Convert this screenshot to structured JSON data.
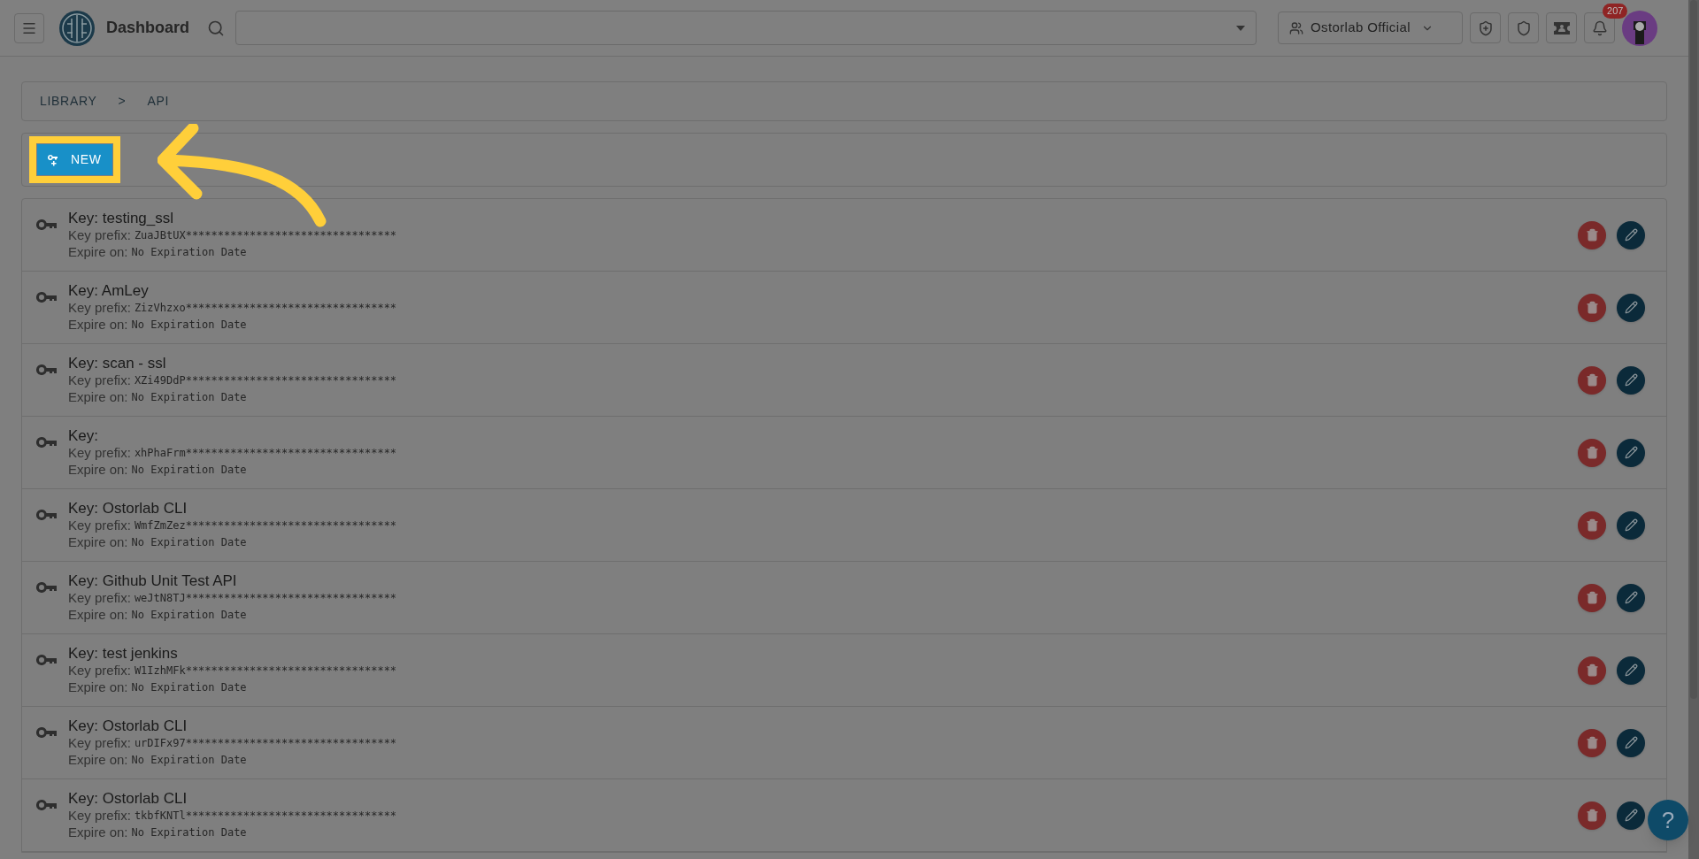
{
  "header": {
    "title": "Dashboard",
    "org_selector": "Ostorlab Official",
    "notification_count": "207"
  },
  "breadcrumb": [
    {
      "label": "LIBRARY"
    },
    {
      "label": ">"
    },
    {
      "label": "API"
    }
  ],
  "new_button": {
    "label": "NEW",
    "highlighted": true
  },
  "keys": [
    {
      "title": "Key: testing_ssl",
      "prefix_label": "Key prefix:",
      "prefix": "ZuaJBtUX*********************************",
      "expire_label": "Expire on:",
      "expire": "No Expiration Date"
    },
    {
      "title": "Key: AmLey",
      "prefix_label": "Key prefix:",
      "prefix": "ZizVhzxo*********************************",
      "expire_label": "Expire on:",
      "expire": "No Expiration Date"
    },
    {
      "title": "Key: scan - ssl",
      "prefix_label": "Key prefix:",
      "prefix": "XZi49DdP*********************************",
      "expire_label": "Expire on:",
      "expire": "No Expiration Date"
    },
    {
      "title": "Key:",
      "prefix_label": "Key prefix:",
      "prefix": "xhPhaFrm*********************************",
      "expire_label": "Expire on:",
      "expire": "No Expiration Date"
    },
    {
      "title": "Key: Ostorlab CLI",
      "prefix_label": "Key prefix:",
      "prefix": "WmfZmZez*********************************",
      "expire_label": "Expire on:",
      "expire": "No Expiration Date"
    },
    {
      "title": "Key: Github Unit Test API",
      "prefix_label": "Key prefix:",
      "prefix": "weJtN8TJ*********************************",
      "expire_label": "Expire on:",
      "expire": "No Expiration Date"
    },
    {
      "title": "Key: test jenkins",
      "prefix_label": "Key prefix:",
      "prefix": "W1IzhMFk*********************************",
      "expire_label": "Expire on:",
      "expire": "No Expiration Date"
    },
    {
      "title": "Key: Ostorlab CLI",
      "prefix_label": "Key prefix:",
      "prefix": "urDIFx97*********************************",
      "expire_label": "Expire on:",
      "expire": "No Expiration Date"
    },
    {
      "title": "Key: Ostorlab CLI",
      "prefix_label": "Key prefix:",
      "prefix": "tkbfKNTl*********************************",
      "expire_label": "Expire on:",
      "expire": "No Expiration Date"
    }
  ],
  "help_button": {
    "label": "?"
  }
}
